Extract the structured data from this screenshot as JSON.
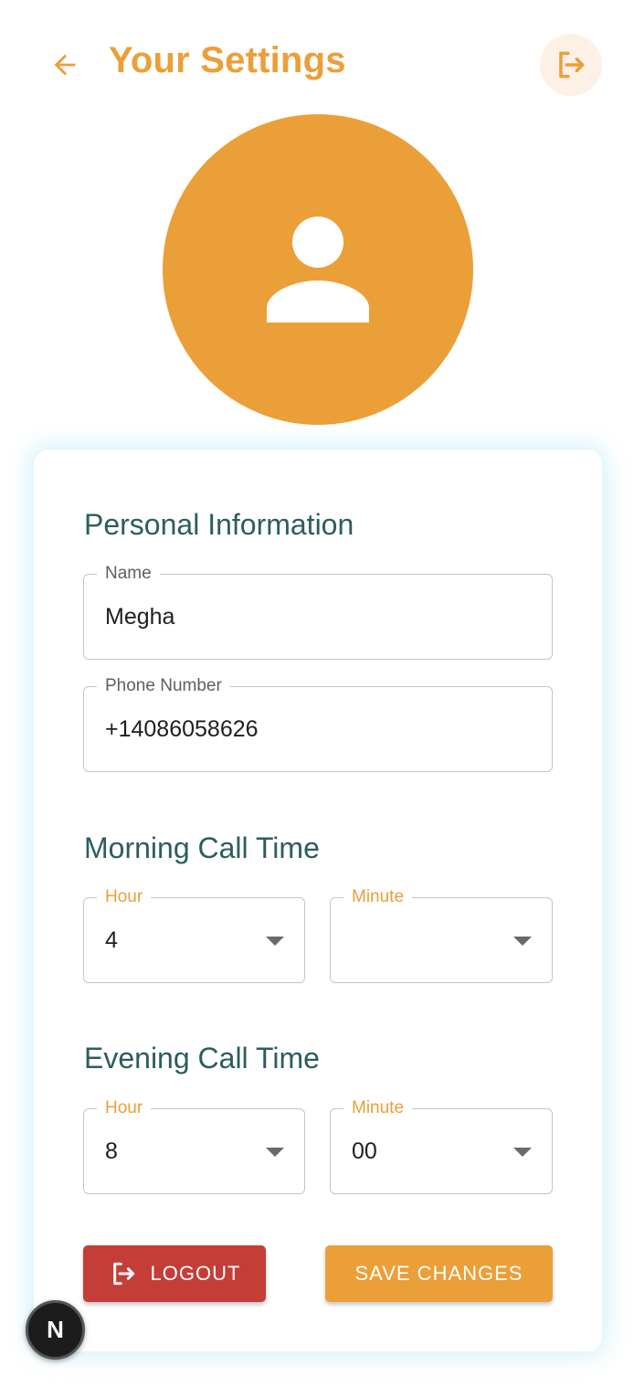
{
  "header": {
    "title": "Your Settings",
    "back_icon": "arrow-left-icon",
    "logout_icon": "logout-icon"
  },
  "avatar": {
    "icon": "person-icon"
  },
  "personal": {
    "title": "Personal Information",
    "name": {
      "label": "Name",
      "value": "Megha"
    },
    "phone": {
      "label": "Phone Number",
      "value": "+14086058626"
    }
  },
  "morning": {
    "title": "Morning Call Time",
    "hour": {
      "label": "Hour",
      "value": "4"
    },
    "minute": {
      "label": "Minute",
      "value": ""
    }
  },
  "evening": {
    "title": "Evening Call Time",
    "hour": {
      "label": "Hour",
      "value": "8"
    },
    "minute": {
      "label": "Minute",
      "value": "00"
    }
  },
  "actions": {
    "logout_label": "LOGOUT",
    "save_label": "SAVE CHANGES"
  },
  "badge": {
    "label": "N"
  },
  "colors": {
    "accent": "#EB9F38",
    "danger": "#C43E37",
    "section_title": "#2D5D5E"
  }
}
